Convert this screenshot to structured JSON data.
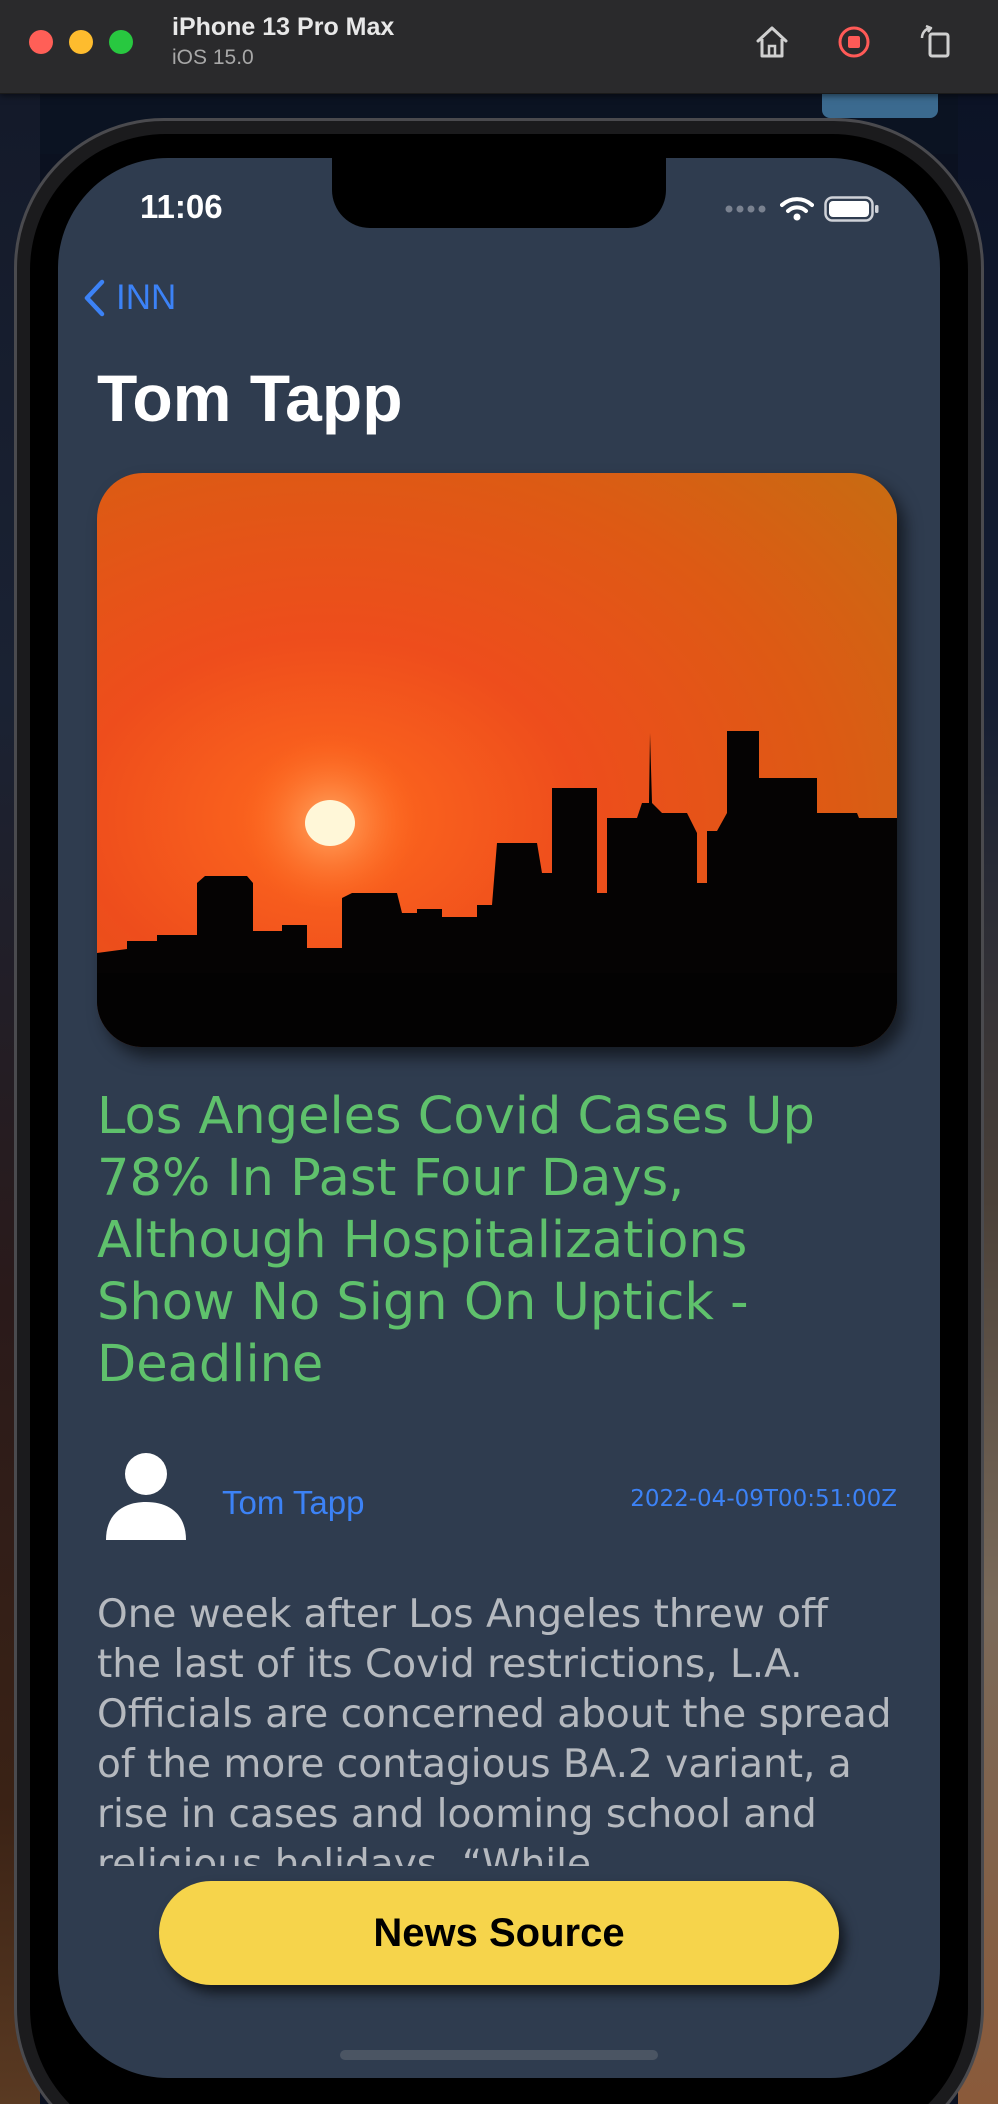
{
  "simulator": {
    "device_name": "iPhone 13 Pro Max",
    "os_version": "iOS 15.0",
    "icons": [
      "home-icon",
      "record-icon",
      "rotate-icon"
    ]
  },
  "status_bar": {
    "time": "11:06"
  },
  "nav": {
    "back_label": "INN"
  },
  "article": {
    "page_title": "Tom Tapp",
    "image_description_icon": "sunset-skyline-photo",
    "headline": "Los Angeles Covid Cases Up 78% In Past Four Days, Although Hospitalizations Show No Sign On Uptick - Deadline",
    "author": "Tom Tapp",
    "published_at": "2022-04-09T00:51:00Z",
    "body": "One week after Los Angeles threw off the last of its Covid restrictions, L.A. Officials are concerned about the spread of the more contagious BA.2 variant, a rise in cases and looming school and religious holidays. “While"
  },
  "actions": {
    "news_source_label": "News Source"
  },
  "colors": {
    "screen_bg": "#2f3c4f",
    "accent_blue": "#3c82f6",
    "headline_green": "#5fc16c",
    "button_yellow": "#f6d44b"
  }
}
